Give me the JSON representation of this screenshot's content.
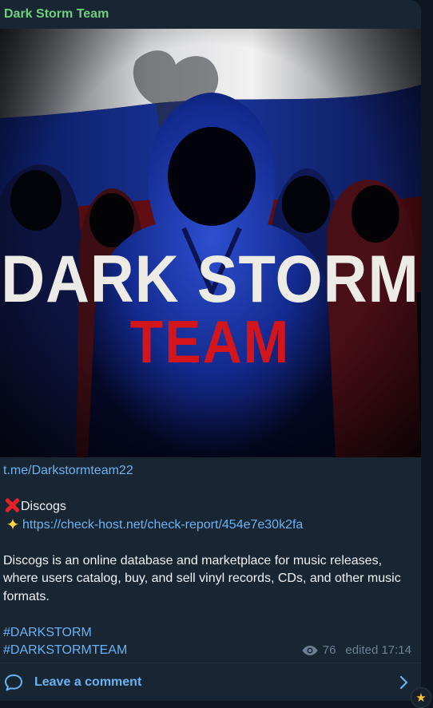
{
  "post": {
    "channel_name": "Dark Storm Team",
    "image": {
      "title_line1": "DARK STORM",
      "title_line2": "TEAM"
    },
    "link": "t.me/Darkstormteam22",
    "entry_title": "Discogs",
    "report_link": "https://check-host.net/check-report/454e7e30k2fa",
    "description": "Discogs is an online database and marketplace for music releases, where users catalog, buy, and sell vinyl records, CDs, and other music formats.",
    "hashtags": [
      "#DARKSTORM",
      "#DARKSTORMTEAM"
    ],
    "views": "76",
    "edited_label": "edited 17:14",
    "comment_label": "Leave a comment"
  },
  "colors": {
    "background": "#0e1621",
    "bubble": "#182533",
    "channel_name": "#6fcf7d",
    "link": "#6ab3f3",
    "meta": "#6d8196",
    "title_white": "#ecebe6",
    "title_red": "#d4161c"
  },
  "icons": {
    "cross": "cross-mark-emoji",
    "star": "glowing-star-emoji",
    "views": "eye-icon",
    "comment": "comment-bubble-icon",
    "chevron": "chevron-right-icon",
    "badge": "star-icon"
  }
}
